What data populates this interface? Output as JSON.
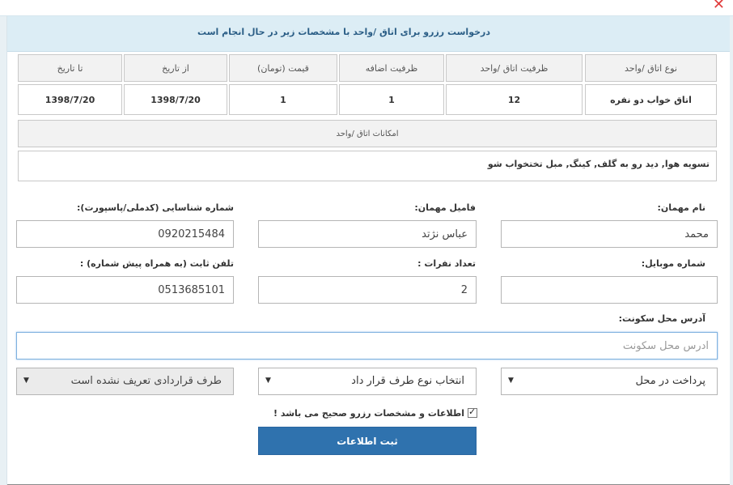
{
  "window": {
    "close_glyph": "✕"
  },
  "header": {
    "title": "درخواست رزرو برای اتاق /واحد با مشخصات زیر در حال انجام است"
  },
  "room_table": {
    "headers": [
      "نوع اتاق /واحد",
      "ظرفیت اتاق /واحد",
      "ظرفیت اضافه",
      "قیمت (تومان)",
      "از تاریخ",
      "تا تاریخ"
    ],
    "values": [
      "اتاق خواب دو نفره",
      "12",
      "1",
      "1",
      "1398/7/20",
      "1398/7/20"
    ]
  },
  "amenities": {
    "header": "امکانات اتاق /واحد",
    "value": "تسویه هوا, دید رو به گلف, کینگ, مبل تختخواب شو"
  },
  "form": {
    "guest_name": {
      "label": "نام مهمان:",
      "value": "محمد"
    },
    "guest_family": {
      "label": "فامیل مهمان:",
      "value": "عباس نژتد"
    },
    "national_id": {
      "label": "شماره شناسایی (کدملی/پاسپورت):",
      "value": "0920215484"
    },
    "mobile": {
      "label": "شماره موبایل:",
      "value": ""
    },
    "guest_count": {
      "label": "تعداد نفرات :",
      "value": "2"
    },
    "landline": {
      "label": "تلفن ثابت (به همراه پیش شماره) :",
      "value": "0513685101"
    },
    "address": {
      "label": "آدرس محل سکونت:",
      "placeholder": "آدرس محل سکونت",
      "value": ""
    },
    "payment_select": {
      "selected": "پرداخت در محل"
    },
    "contract_type_select": {
      "selected": "انتخاب نوع طرف قرار داد"
    },
    "contract_party_select": {
      "selected": "طرف قراردادی تعریف نشده است"
    },
    "confirm_checkbox": {
      "label": "اطلاعات و مشخصات رزرو صحیح می باشد !",
      "checked": true
    },
    "submit_label": "ثبت اطلاعات"
  },
  "icons": {
    "dropdown": "caret-down-icon",
    "close": "close-icon",
    "check": "checkmark-icon"
  },
  "colors": {
    "header_bg": "#dcedf5",
    "header_text": "#2b5e86",
    "submit_bg": "#2f72ae",
    "close": "#e03b3b"
  }
}
